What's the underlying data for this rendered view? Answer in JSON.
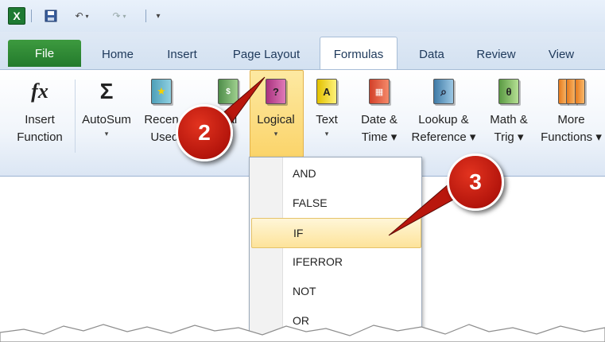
{
  "app_icon": "excel-icon",
  "qat": {
    "save_icon": "save-icon",
    "undo_icon": "undo-icon",
    "redo_icon": "redo-icon",
    "customize_icon": "customize-qat-icon"
  },
  "tabs": [
    {
      "label": "File"
    },
    {
      "label": "Home"
    },
    {
      "label": "Insert"
    },
    {
      "label": "Page Layout"
    },
    {
      "label": "Formulas"
    },
    {
      "label": "Data"
    },
    {
      "label": "Review"
    },
    {
      "label": "View"
    }
  ],
  "active_tab": "Formulas",
  "ribbon": {
    "insert_function": {
      "line1": "Insert",
      "line2": "Function",
      "glyph": "fx"
    },
    "autosum": {
      "line1": "AutoSum",
      "arrow": "▾",
      "glyph": "Σ"
    },
    "recently_used": {
      "line1": "Recen",
      "line2": "Used"
    },
    "financial": {
      "line1": "cial"
    },
    "logical": {
      "line1": "Logical",
      "arrow": "▾",
      "glyph": "?"
    },
    "text": {
      "line1": "Text",
      "arrow": "▾",
      "glyph": "A"
    },
    "date_time": {
      "line1": "Date &",
      "line2": "Time ▾"
    },
    "lookup_reference": {
      "line1": "Lookup &",
      "line2": "Reference ▾"
    },
    "math_trig": {
      "line1": "Math &",
      "line2": "Trig ▾",
      "glyph": "θ"
    },
    "more_functions": {
      "line1": "More",
      "line2": "Functions ▾"
    }
  },
  "logical_menu": {
    "items": [
      "AND",
      "FALSE",
      "IF",
      "IFERROR",
      "NOT",
      "OR"
    ],
    "highlighted": "IF"
  },
  "callouts": {
    "step2": "2",
    "step3": "3"
  },
  "colors": {
    "file_tab": "#2f8a35",
    "highlight": "#fbd46a",
    "callout": "#c41d10"
  }
}
